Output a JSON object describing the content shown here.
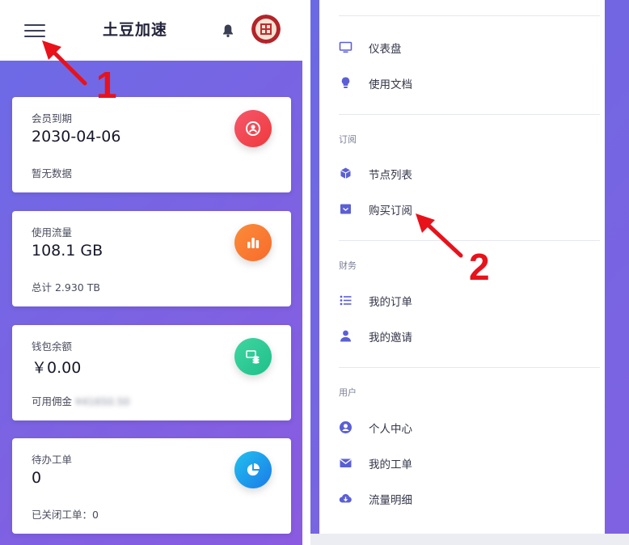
{
  "left_screen": {
    "app_title": "土豆加速",
    "cards": [
      {
        "title": "会员到期",
        "value": "2030-04-06",
        "sub": "暂无数据",
        "icon": "user-circle-icon",
        "color": "#f0393b"
      },
      {
        "title": "使用流量",
        "value": "108.1 GB",
        "sub": "总计 2.930 TB",
        "icon": "bar-chart-icon",
        "color": "#f86b2b"
      },
      {
        "title": "钱包余额",
        "value": "￥0.00",
        "sub_label": "可用佣金",
        "sub_blurred": "¥41650.50",
        "icon": "wallet-coins-icon",
        "color": "#1fbf8a"
      },
      {
        "title": "待办工单",
        "value": "0",
        "sub": "已关闭工单：0",
        "icon": "pie-chart-icon",
        "color": "#1a7ae9"
      }
    ]
  },
  "right_screen": {
    "menu": {
      "top_items": [
        {
          "label": "仪表盘",
          "icon": "monitor-icon"
        },
        {
          "label": "使用文档",
          "icon": "lightbulb-icon"
        }
      ],
      "sections": [
        {
          "title": "订阅",
          "items": [
            {
              "label": "节点列表",
              "icon": "cube-icon"
            },
            {
              "label": "购买订阅",
              "icon": "archive-box-icon"
            }
          ]
        },
        {
          "title": "财务",
          "items": [
            {
              "label": "我的订单",
              "icon": "list-icon"
            },
            {
              "label": "我的邀请",
              "icon": "person-icon"
            }
          ]
        },
        {
          "title": "用户",
          "items": [
            {
              "label": "个人中心",
              "icon": "user-circle-icon"
            },
            {
              "label": "我的工单",
              "icon": "envelope-icon"
            },
            {
              "label": "流量明细",
              "icon": "cloud-download-icon"
            }
          ]
        }
      ]
    }
  },
  "annotations": {
    "step1": "1",
    "step2": "2"
  },
  "colors": {
    "accent": "#6f6ae6",
    "menu_icon": "#5b5fd6",
    "annotation": "#e8121b"
  }
}
